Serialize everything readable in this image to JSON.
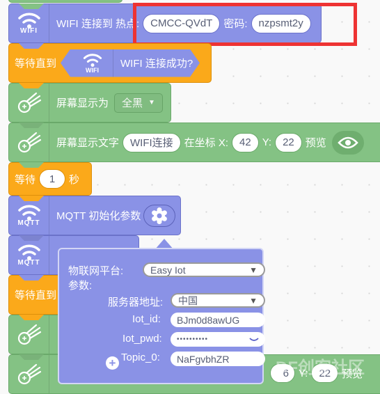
{
  "blocks": {
    "wifi_connect": {
      "icon_label": "WIFI",
      "text": "WIFI 连接到 热点:",
      "ssid": "CMCC-QVdT",
      "password_label": "密码:",
      "password": "nzpsmt2y"
    },
    "wait_until_1": {
      "text": "等待直到",
      "icon_label": "WIFI",
      "condition": "WIFI 连接成功?"
    },
    "screen_fill": {
      "text": "屏幕显示为",
      "option": "全黑"
    },
    "screen_text": {
      "text": "屏幕显示文字",
      "value": "WIFI连接",
      "coord_label": "在坐标 X:",
      "x": "42",
      "y_label": "Y:",
      "y": "22",
      "preview": "预览"
    },
    "wait_seconds": {
      "text": "等待",
      "value": "1",
      "unit": "秒"
    },
    "mqtt_init": {
      "icon_label": "MQTT",
      "text": "MQTT 初始化参数"
    },
    "mqtt_second": {
      "icon_label": "MQTT"
    },
    "wait_until_2": {
      "text": "等待直到"
    },
    "bottom_text": {
      "x_partial": "6",
      "y_label": "Y:",
      "y": "22",
      "preview": "预览"
    }
  },
  "popup": {
    "platform_label": "物联网平台:",
    "platform_value": "Easy Iot",
    "params_label": "参数:",
    "server_label": "服务器地址:",
    "server_value": "中国",
    "iot_id_label": "Iot_id:",
    "iot_id_value": "BJm0d8awUG",
    "iot_pwd_label": "Iot_pwd:",
    "iot_pwd_value": "••••••••••",
    "topic_label": "Topic_0:",
    "topic_value": "NaFgvbhZR"
  },
  "watermark": "DF创客社区",
  "colors": {
    "purple": "#8a92e6",
    "orange": "#fba91a",
    "green": "#84c284",
    "highlight": "#ee3333"
  }
}
